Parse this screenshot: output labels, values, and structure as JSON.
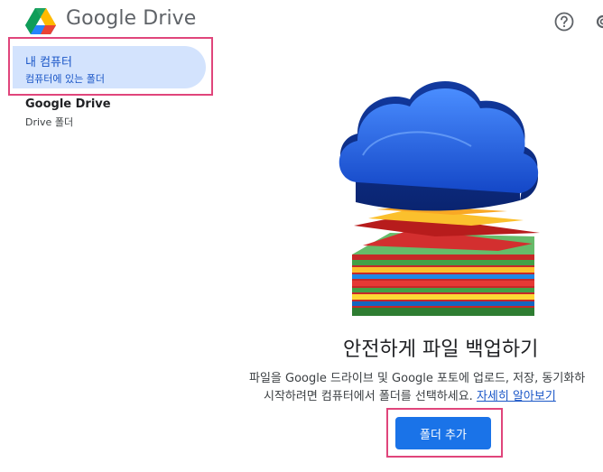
{
  "header": {
    "brand": "Google Drive"
  },
  "sidebar": {
    "items": [
      {
        "title": "내 컴퓨터",
        "subtitle": "컴퓨터에 있는 폴더",
        "selected": true
      },
      {
        "title": "Google Drive",
        "subtitle": "Drive 폴더",
        "selected": false
      }
    ]
  },
  "main": {
    "title": "안전하게 파일 백업하기",
    "desc_line1": "파일을 Google 드라이브 및 Google 포토에 업로드, 저장, 동기화하",
    "desc_line2": "시작하려면 컴퓨터에서 폴더를 선택하세요.",
    "learn_more": "자세히 알아보기",
    "add_button": "폴더 추가"
  },
  "colors": {
    "accent": "#1a73e8",
    "selected_bg": "#d3e3fd",
    "highlight": "#e0457b"
  }
}
